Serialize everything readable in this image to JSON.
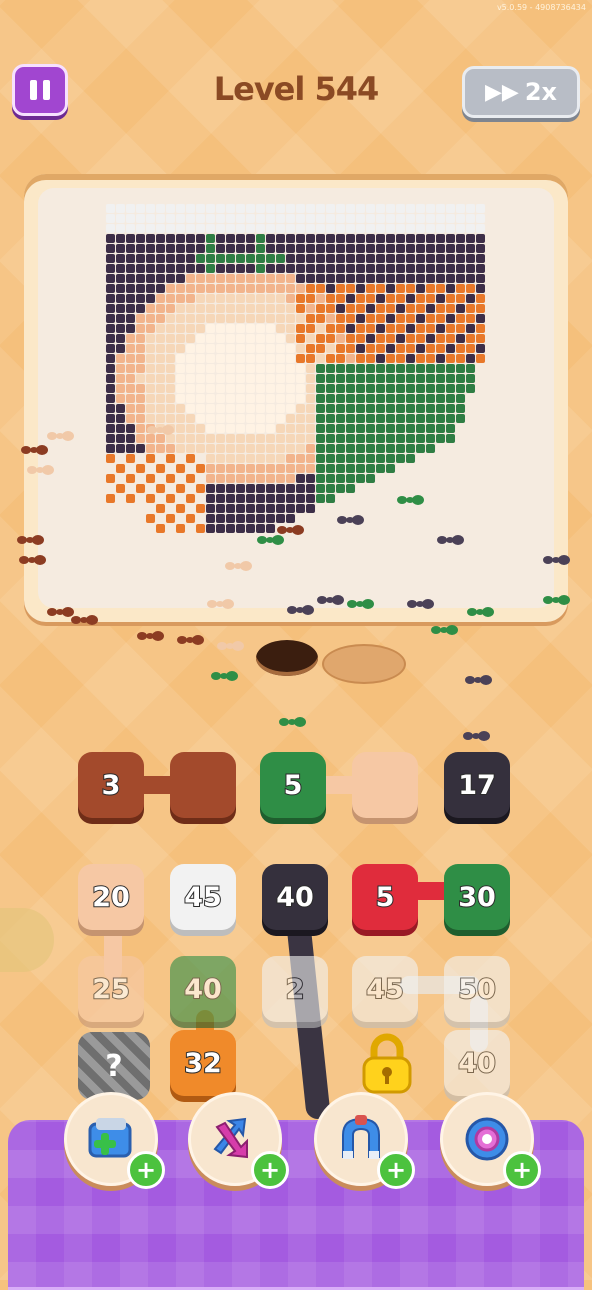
{
  "app": {
    "version": "v5.0.59 - 4908736434",
    "level_title": "Level 544",
    "speed_label": "2x"
  },
  "colors": {
    "brown": "#a34a2c",
    "green": "#2f8e46",
    "peach": "#f6c8a4",
    "dark": "#35303d",
    "white": "#f2f2f2",
    "red": "#e02c3c",
    "orange": "#f08a2a",
    "purple": "#a45be0"
  },
  "icons": {
    "pause": "pause-icon",
    "fast_forward": "fast-forward-icon",
    "lock": "lock-icon",
    "add_slot": "add-slot-icon",
    "shuffle": "shuffle-icon",
    "magnet": "magnet-icon",
    "rope": "rope-icon"
  },
  "top_row": [
    {
      "value": "3",
      "color": "brown"
    },
    {
      "value": "",
      "color": "brown"
    },
    {
      "value": "5",
      "color": "green"
    },
    {
      "value": "",
      "color": "peach"
    },
    {
      "value": "17",
      "color": "dark"
    }
  ],
  "grid": {
    "row1": [
      {
        "value": "20",
        "color": "peach"
      },
      {
        "value": "45",
        "color": "white"
      },
      {
        "value": "40",
        "color": "dark"
      },
      {
        "value": "5",
        "color": "red"
      },
      {
        "value": "30",
        "color": "green"
      }
    ],
    "row2": [
      {
        "value": "25",
        "color": "peach"
      },
      {
        "value": "40",
        "color": "green"
      },
      {
        "value": "2",
        "color": "white"
      },
      {
        "value": "45",
        "color": "white"
      },
      {
        "value": "50",
        "color": "white"
      }
    ],
    "row3": [
      {
        "value": "?",
        "color": "grey"
      },
      {
        "value": "32",
        "color": "orange"
      },
      {
        "value": "",
        "color": "none"
      },
      {
        "value": "lock",
        "color": "yellow"
      },
      {
        "value": "40",
        "color": "white"
      }
    ]
  },
  "boosters": [
    {
      "name": "add-slot",
      "plus": "+"
    },
    {
      "name": "shuffle",
      "plus": "+"
    },
    {
      "name": "magnet",
      "plus": "+"
    },
    {
      "name": "rope",
      "plus": "+"
    }
  ]
}
